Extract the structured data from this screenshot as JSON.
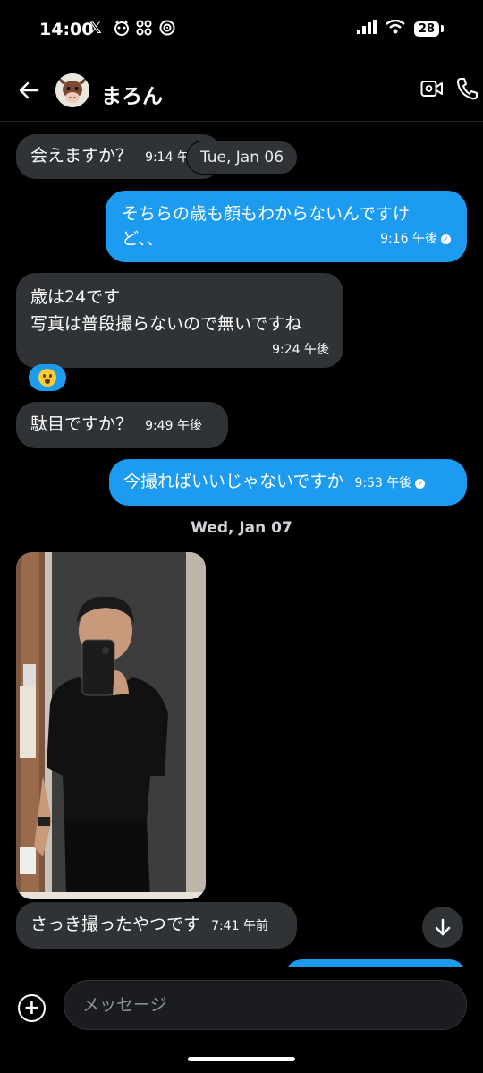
{
  "status_bar": {
    "time": "14:00",
    "battery": "28",
    "icons": [
      "x-logo-icon",
      "pet-app-icon",
      "grid-app-icon",
      "hotspot-icon",
      "signal-icon",
      "wifi-icon",
      "battery-icon"
    ]
  },
  "header": {
    "name": "まろん",
    "icons": [
      "back-arrow-icon",
      "video-call-icon",
      "phone-icon"
    ]
  },
  "date_labels": {
    "jan06": "Tue, Jan 06",
    "jan07": "Wed, Jan 07"
  },
  "messages": [
    {
      "dir": "in",
      "text": "会えますか？",
      "time": "9:14 午後"
    },
    {
      "dir": "out",
      "line1": "そちらの歳も顔もわからないんですけ",
      "line2": "ど、、",
      "time": "9:16 午後"
    },
    {
      "dir": "in",
      "line1": "歳は24です",
      "line2": "写真は普段撮らないので無いですね",
      "time": "9:24 午後",
      "reaction": "astonished-face-emoji"
    },
    {
      "dir": "in",
      "text": "駄目ですか？",
      "time": "9:49 午後"
    },
    {
      "dir": "out",
      "text": "今撮ればいいじゃないですか",
      "time": "9:53 午後"
    },
    {
      "dir": "in",
      "type": "image",
      "image": "mirror-selfie-photo"
    },
    {
      "dir": "in",
      "text": "さっき撮ったやつです",
      "time": "7:41 午前"
    }
  ],
  "composer": {
    "placeholder": "メッセージ"
  },
  "colors": {
    "incoming": "#2f3336",
    "outgoing": "#1d9bf0",
    "background": "#000000"
  }
}
